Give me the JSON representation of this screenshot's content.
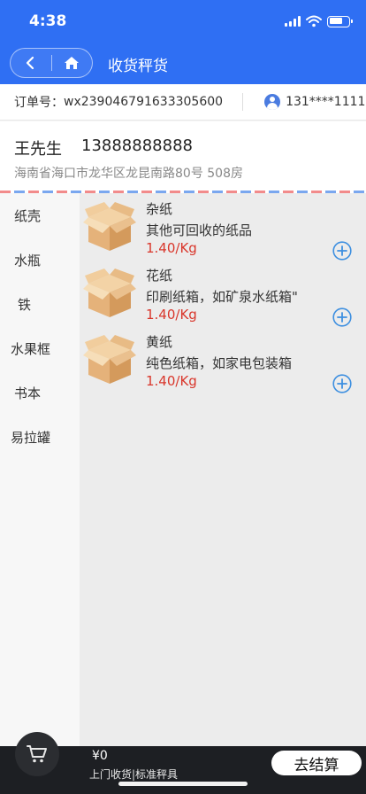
{
  "status_bar": {
    "time": "4:38"
  },
  "nav": {
    "title": "收货秤货"
  },
  "order": {
    "label": "订单号：",
    "number": "wx239046791633305600",
    "phone_masked": "131****1111"
  },
  "address": {
    "name": "王先生",
    "phone": "13888888888",
    "line": "海南省海口市龙华区龙昆南路80号 508房"
  },
  "categories": [
    {
      "label": "纸壳"
    },
    {
      "label": "水瓶"
    },
    {
      "label": "铁"
    },
    {
      "label": "水果框"
    },
    {
      "label": "书本"
    },
    {
      "label": "易拉罐"
    }
  ],
  "products": [
    {
      "name": "杂纸",
      "desc": "其他可回收的纸品",
      "price": "1.40/Kg"
    },
    {
      "name": "花纸",
      "desc": "印刷纸箱，如矿泉水纸箱\"",
      "price": "1.40/Kg"
    },
    {
      "name": "黄纸",
      "desc": "纯色纸箱，如家电包装箱",
      "price": "1.40/Kg"
    }
  ],
  "bottom": {
    "total": "¥0",
    "service": "上门收货|标准秤具",
    "checkout_label": "去结算"
  },
  "colors": {
    "primary": "#2f6ff3",
    "price": "#d9362b",
    "bottom_bar": "#1d1f23",
    "add_icon": "#3d8fe0"
  }
}
